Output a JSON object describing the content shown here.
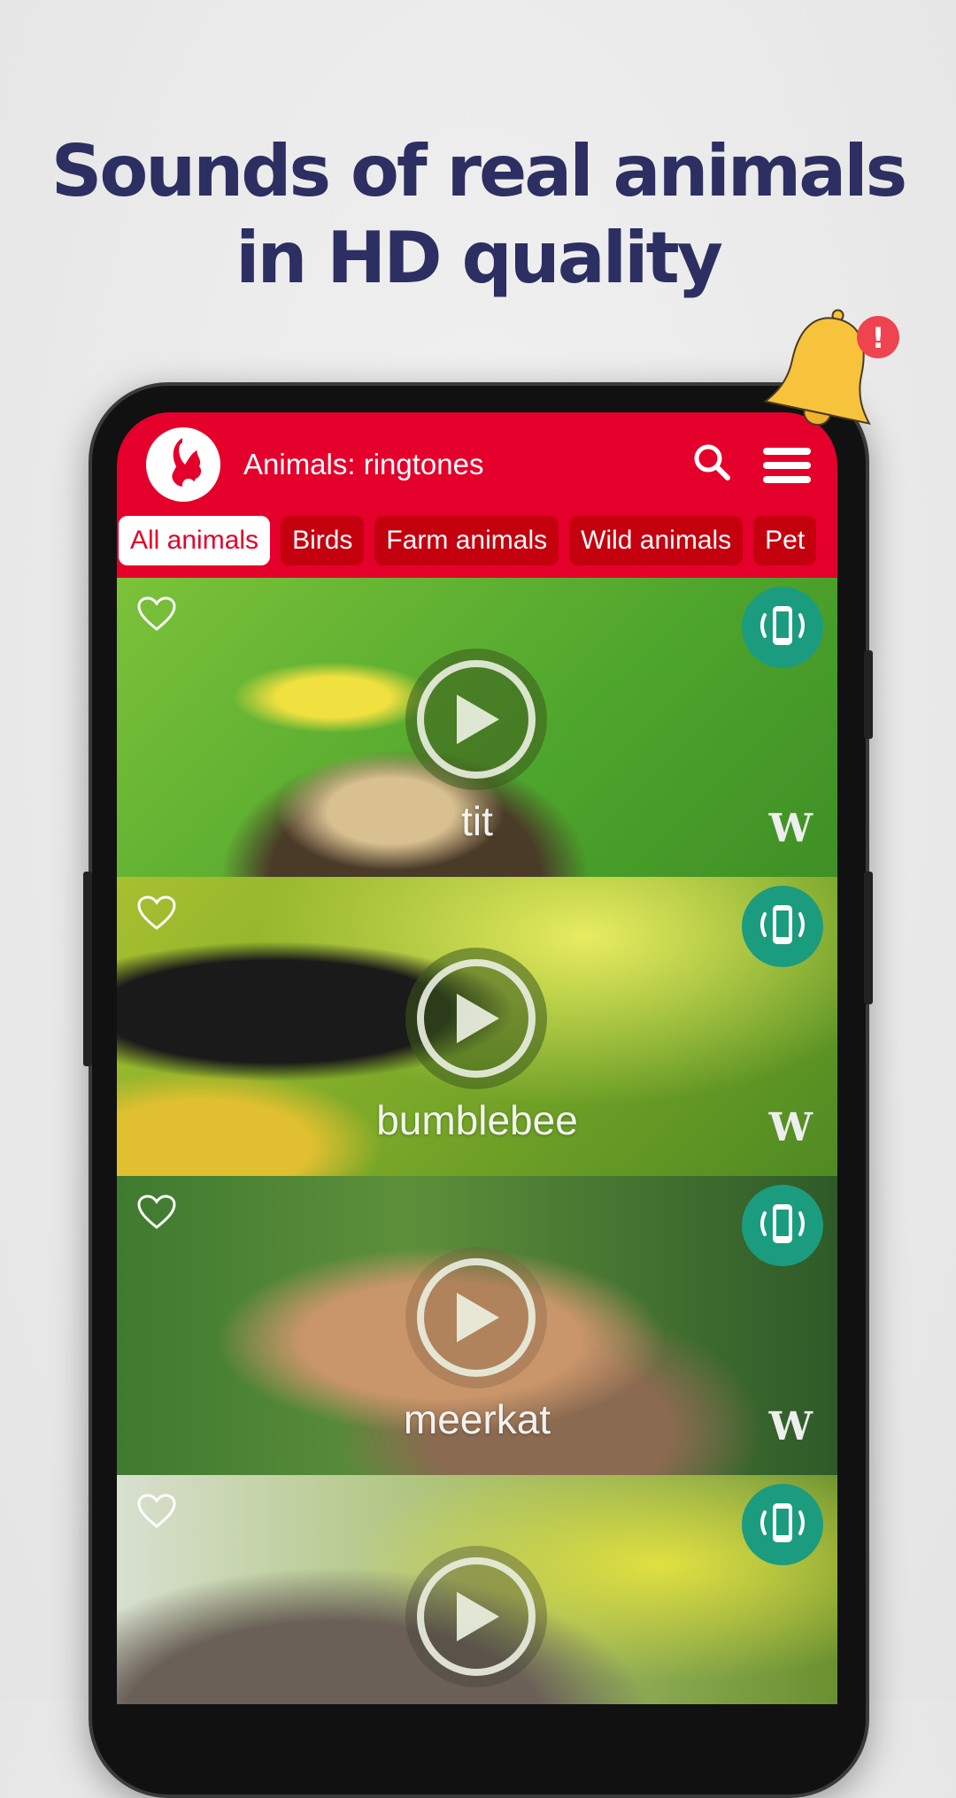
{
  "headline": {
    "line1": "Sounds of real animals",
    "line2": "in HD quality"
  },
  "app": {
    "title": "Animals: ringtones",
    "brand_color": "#e4002b",
    "search_icon": "search-icon",
    "menu_icon": "hamburger-menu-icon"
  },
  "categories": [
    {
      "label": "All animals",
      "selected": true
    },
    {
      "label": "Birds"
    },
    {
      "label": "Farm animals"
    },
    {
      "label": "Wild animals"
    },
    {
      "label": "Pet"
    }
  ],
  "sounds": [
    {
      "name": "tit",
      "source_logo": "W"
    },
    {
      "name": "bumblebee",
      "source_logo": "W"
    },
    {
      "name": "meerkat",
      "source_logo": "W"
    },
    {
      "name": "",
      "source_logo": ""
    }
  ],
  "notification_badge": "!"
}
